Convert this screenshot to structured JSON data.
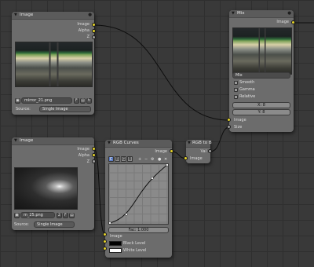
{
  "colors": {
    "background": "#393939",
    "node_body": "#6c6c6c",
    "node_header": "#5b5b5b",
    "socket_color": "#e6d42a",
    "socket_value": "#a0a0a0",
    "selected_channel": "#5678c0"
  },
  "nodes": {
    "image1": {
      "title": "Image",
      "outputs": [
        "Image",
        "Alpha",
        "Z"
      ],
      "filename": "mirror_21.png",
      "frame_field": "F",
      "source_label": "Source:",
      "source_value": "Single Image",
      "preview_icon": "subway-tunnel-preview"
    },
    "image2": {
      "title": "Image",
      "outputs": [
        "Image",
        "Alpha",
        "Z"
      ],
      "filename": "m_25.png",
      "frame_field": "2",
      "frame_flag": "F",
      "source_label": "Source:",
      "source_value": "Single Image",
      "preview_icon": "light-flare-preview"
    },
    "rgb_curves": {
      "title": "RGB Curves",
      "output": "Image",
      "channels": [
        "C",
        "R",
        "G",
        "B"
      ],
      "tool_icons": [
        "plus-icon",
        "minus-icon",
        "wrench-icon",
        "clip-icon",
        "close-icon"
      ],
      "fac_value": "Fac: 1.000",
      "inputs": [
        "Image",
        "Black Level",
        "White Level"
      ],
      "black_level_color": "#000000",
      "white_level_color": "#ffffff"
    },
    "rgb_to_bw": {
      "title": "RGB to B",
      "output": "Val",
      "input": "Image"
    },
    "mix": {
      "title": "Mix",
      "output": "Image",
      "blend_mode": "Mix",
      "checkboxes": [
        {
          "label": "Smooth",
          "checked": false
        },
        {
          "label": "Gamma",
          "checked": false
        },
        {
          "label": "Relative",
          "checked": false
        }
      ],
      "x_field": "X: 8",
      "y_field": "Y: 8",
      "inputs": [
        "Image",
        "Size"
      ],
      "preview_icon": "subway-tunnel-preview"
    }
  }
}
